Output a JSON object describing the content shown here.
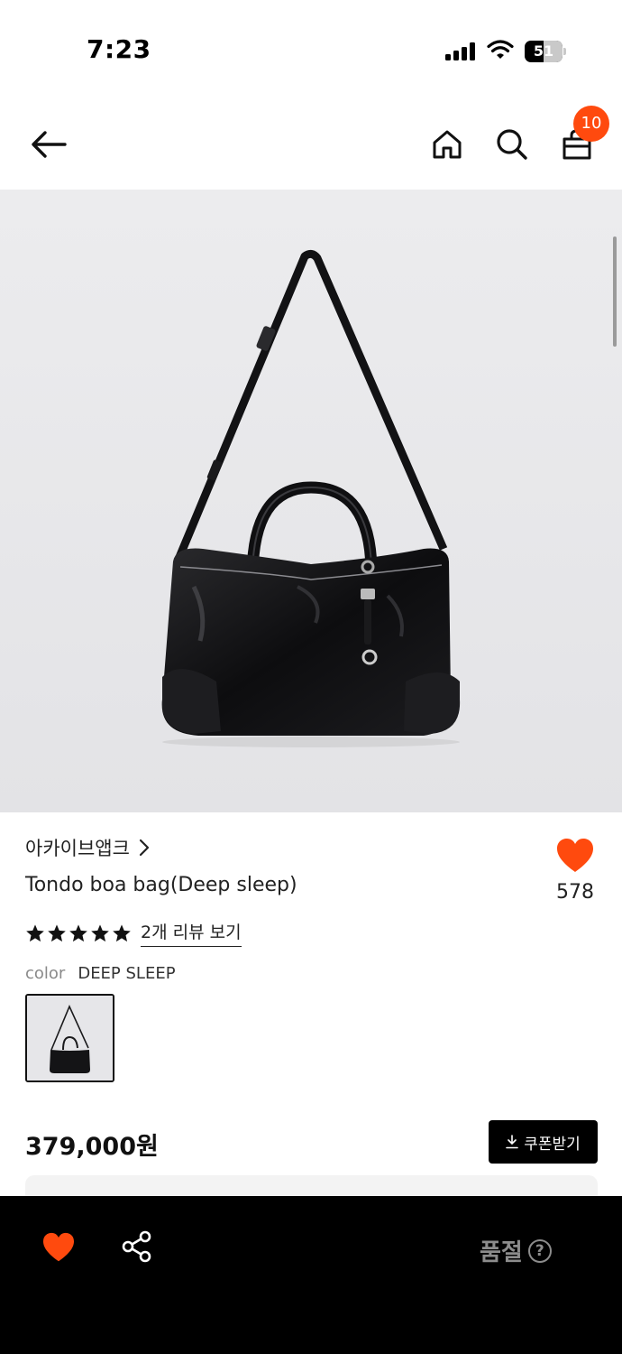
{
  "status_bar": {
    "time": "7:23",
    "battery": "51",
    "battery_fraction": 0.51
  },
  "header": {
    "back_icon": "arrow-left-icon",
    "home_icon": "home-icon",
    "search_icon": "search-icon",
    "cart_icon": "shopping-bag-icon",
    "cart_count": "10",
    "badge_color": "#ff4a0e"
  },
  "product": {
    "brand": "아카이브앱크",
    "name": "Tondo boa bag(Deep sleep)",
    "like_count": "578",
    "rating_stars": 5,
    "review_link": "2개 리뷰 보기",
    "color_label": "color",
    "color_value": "DEEP SLEEP",
    "price": "379,000원",
    "coupon_button": "쿠폰받기",
    "accent_color": "#ff4a0e"
  },
  "bottom_bar": {
    "like_icon": "heart-icon",
    "share_icon": "share-icon",
    "status": "품절",
    "help_icon": "?"
  }
}
